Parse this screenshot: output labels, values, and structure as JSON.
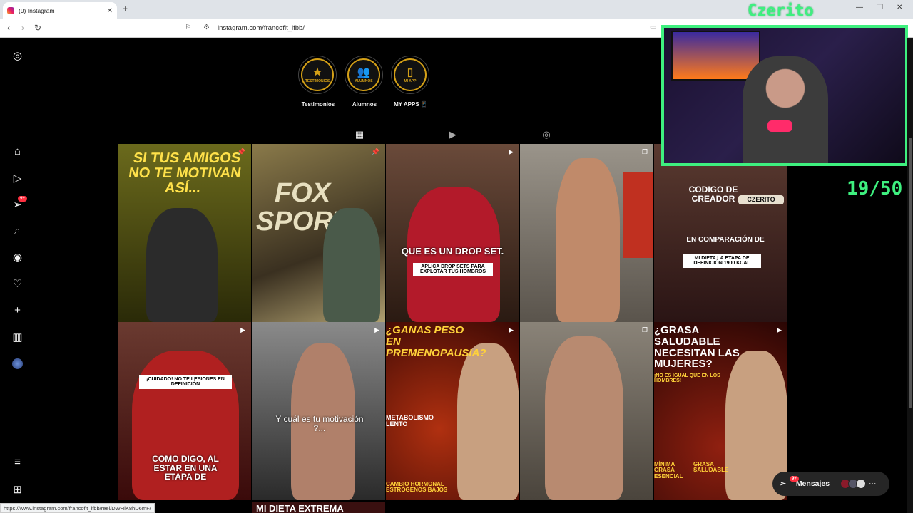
{
  "browser": {
    "tab_title": "(9) Instagram",
    "url": "instagram.com/francofit_ifbb/",
    "status_url": "https://www.instagram.com/francofit_ifbb/reel/DWHlK8hD6mF/"
  },
  "sidebar": {
    "items": [
      {
        "name": "instagram-logo-icon"
      },
      {
        "name": "home-icon"
      },
      {
        "name": "reels-icon"
      },
      {
        "name": "messages-icon",
        "badge": "9+"
      },
      {
        "name": "search-icon"
      },
      {
        "name": "explore-icon"
      },
      {
        "name": "notifications-icon"
      },
      {
        "name": "create-icon"
      },
      {
        "name": "dashboard-icon"
      },
      {
        "name": "profile-avatar"
      },
      {
        "name": "menu-icon"
      },
      {
        "name": "also-from-meta-icon"
      }
    ]
  },
  "highlights": [
    {
      "label": "Testimonios",
      "inner": "TESTIMONIOS",
      "glyph": "★"
    },
    {
      "label": "Alumnos",
      "inner": "ALUMNOS",
      "glyph": "👥"
    },
    {
      "label": "MY APPS 📱",
      "inner": "MI APP",
      "glyph": "▯"
    }
  ],
  "profile_tabs": [
    {
      "name": "posts-tab",
      "glyph": "▦"
    },
    {
      "name": "reels-tab",
      "glyph": "▶"
    },
    {
      "name": "tagged-tab",
      "glyph": "◎"
    }
  ],
  "posts": [
    {
      "caption": "SI TUS AMIGOS NO TE MOTIVAN ASÍ...",
      "bg": "#4a4a12"
    },
    {
      "caption": "FOX SPORTS",
      "bg": "#6b5a2a"
    },
    {
      "caption": "QUE ES UN DROP SET.",
      "sub": "APLICA DROP SETS PARA EXPLOTAR TUS HOMBROS",
      "bg": "#5a3a2a"
    },
    {
      "caption": "",
      "bg": "#8a8378"
    },
    {
      "caption": "CODIGO DE CREADOR",
      "sub": "EN COMPARACIÓN DE",
      "sub2": "MI DIETA LA ETAPA DE DEFINICIÓN 1900 KCAL",
      "tag": "CZERITO",
      "bg": "#4a2222"
    },
    {
      "caption": "COMO DIGO, AL ESTAR EN UNA ETAPA DE",
      "sub": "¡CUIDADO! NO TE LESIONES EN DEFINICIÓN",
      "bg": "#5a1a1a"
    },
    {
      "caption": "Y cuál es tu motivación ?...",
      "bg": "#3a3a3a"
    },
    {
      "caption": "¿GANAS PESO EN PREMENOPAUSIA?",
      "sub": "METABOLISMO LENTO",
      "sub2": "CAMBIO HORMONAL ESTRÓGENOS BAJOS",
      "bg": "#5a1408"
    },
    {
      "caption": "",
      "bg": "#6a6258"
    },
    {
      "caption": "¿GRASA SALUDABLE NECESITAN LAS MUJERES?",
      "sub": "¡NO ES IGUAL QUE EN LOS HOMBRES!",
      "sub2": "MÍNIMA GRASA ESENCIAL",
      "sub3": "GRASA SALUDABLE",
      "bg": "#4a0e08"
    }
  ],
  "next_row_caption": "MI DIETA EXTREMA",
  "messages": {
    "label": "Mensajes",
    "badge": "9+"
  },
  "overlay": {
    "streamer": "Czerito",
    "counter": "19/50"
  }
}
